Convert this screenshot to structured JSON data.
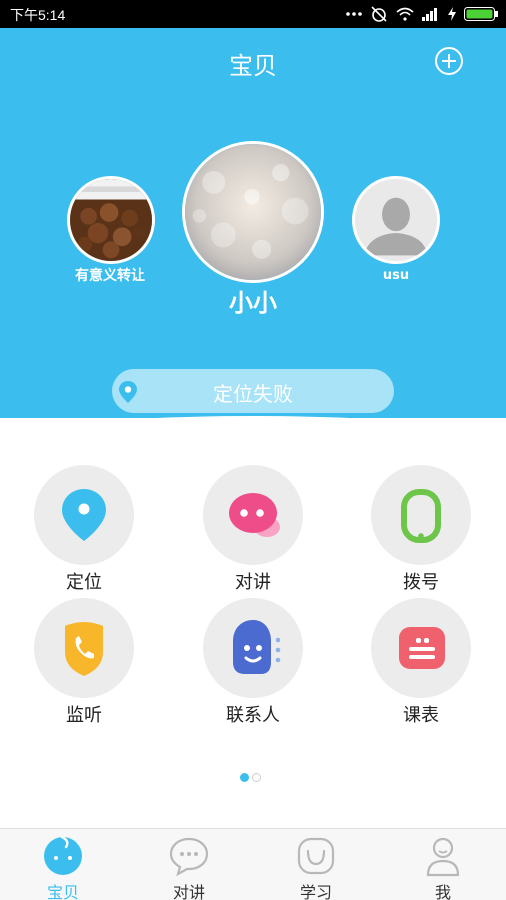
{
  "status_bar": {
    "time": "下午5:14"
  },
  "header": {
    "title": "宝贝"
  },
  "children": {
    "left": {
      "name": "有意义转让"
    },
    "center": {
      "name": "小小"
    },
    "right": {
      "name": "usu"
    }
  },
  "location": {
    "status": "定位失败"
  },
  "features": [
    {
      "label": "定位",
      "icon": "location-pin-icon"
    },
    {
      "label": "对讲",
      "icon": "chat-bubble-icon"
    },
    {
      "label": "拨号",
      "icon": "phone-dial-icon"
    },
    {
      "label": "监听",
      "icon": "phone-shield-icon"
    },
    {
      "label": "联系人",
      "icon": "contact-person-icon"
    },
    {
      "label": "课表",
      "icon": "schedule-icon"
    }
  ],
  "pager": {
    "current_page": 1,
    "total_pages": 2
  },
  "bottom_nav": [
    {
      "label": "宝贝",
      "icon": "baby-icon",
      "active": true
    },
    {
      "label": "对讲",
      "icon": "chat-icon",
      "active": false
    },
    {
      "label": "学习",
      "icon": "smile-box-icon",
      "active": false
    },
    {
      "label": "我",
      "icon": "user-icon",
      "active": false
    }
  ],
  "colors": {
    "primary": "#3bbeee",
    "location_bar": "#a9e3f7",
    "grid_circle": "#ececec"
  }
}
